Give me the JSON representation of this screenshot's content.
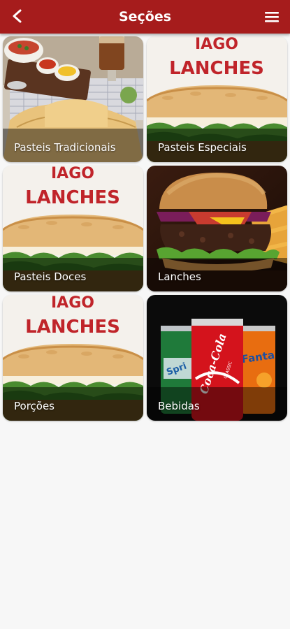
{
  "header": {
    "title": "Seções",
    "back_icon": "back-arrow-icon",
    "menu_icon": "hamburger-menu-icon",
    "background": "#a61c1c"
  },
  "logo_text": {
    "line1": "IAGO",
    "line2": "LANCHES"
  },
  "cola_can_text": {
    "brand": "Coca-Cola",
    "classic": "CLASSIC"
  },
  "sprite_can_text": "Spri",
  "fanta_can_text": "Fanta",
  "sections": [
    {
      "label": "Pasteis Tradicionais",
      "image": "pastel-plate-photo"
    },
    {
      "label": "Pasteis Especiais",
      "image": "iago-lanches-logo-sandwich"
    },
    {
      "label": "Pasteis Doces",
      "image": "iago-lanches-logo-sandwich"
    },
    {
      "label": "Lanches",
      "image": "burger-photo"
    },
    {
      "label": "Porções",
      "image": "iago-lanches-logo-sandwich"
    },
    {
      "label": "Bebidas",
      "image": "soda-cans-photo"
    }
  ]
}
